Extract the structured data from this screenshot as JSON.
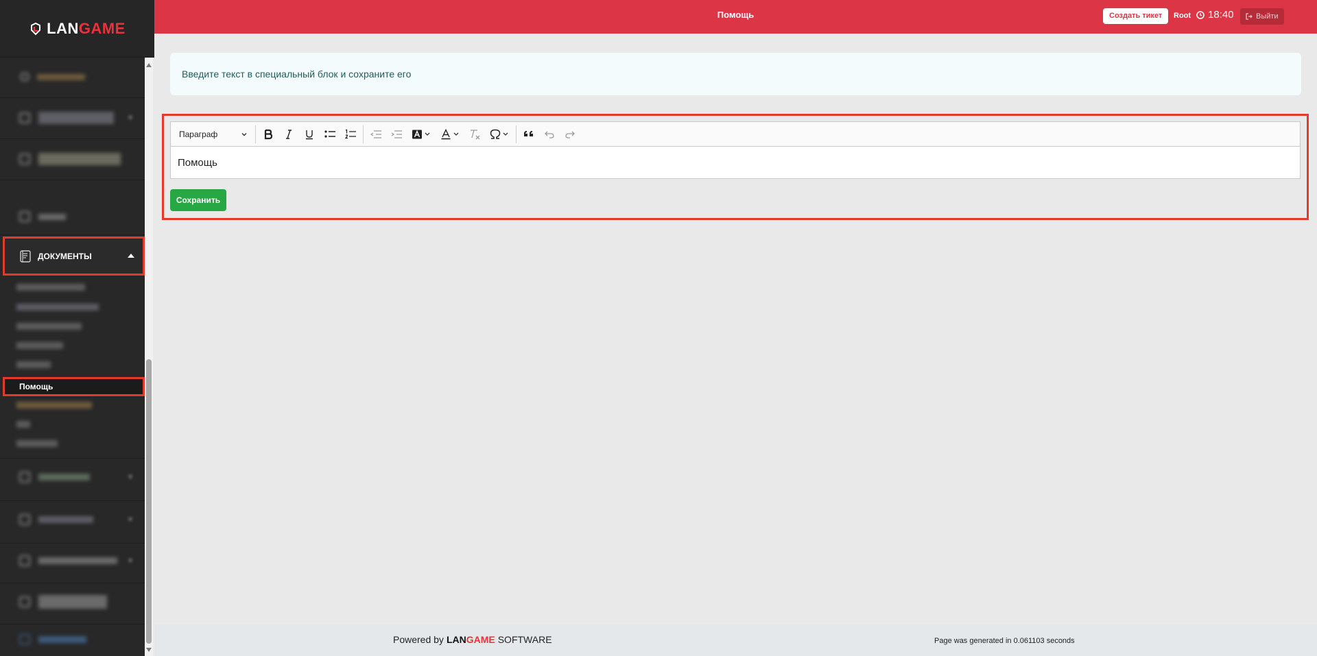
{
  "brand": {
    "logo_lan": "LAN",
    "logo_game": "GAME"
  },
  "header": {
    "title": "Помощь",
    "create_ticket_label": "Создать тикет",
    "user": "Root",
    "time": "18:40",
    "logout_label": "Выйти",
    "color": "#dc3545"
  },
  "sidebar": {
    "docs_label": "ДОКУМЕНТЫ",
    "active_sub_label": "Помощь"
  },
  "alert": {
    "text": "Введите текст в специальный блок и сохраните его"
  },
  "editor": {
    "paragraph_label": "Параграф",
    "content": "Помощь",
    "save_label": "Сохранить"
  },
  "footer": {
    "powered_prefix": "Powered by",
    "brand_lan": "LAN",
    "brand_game": "GAME",
    "powered_suffix": "SOFTWARE",
    "generated": "Page was generated in 0.061103 seconds"
  },
  "colors": {
    "accent_red": "#dc3545",
    "save_green": "#28a745",
    "sidebar_bg": "#282828",
    "highlight": "#e23b2c"
  }
}
